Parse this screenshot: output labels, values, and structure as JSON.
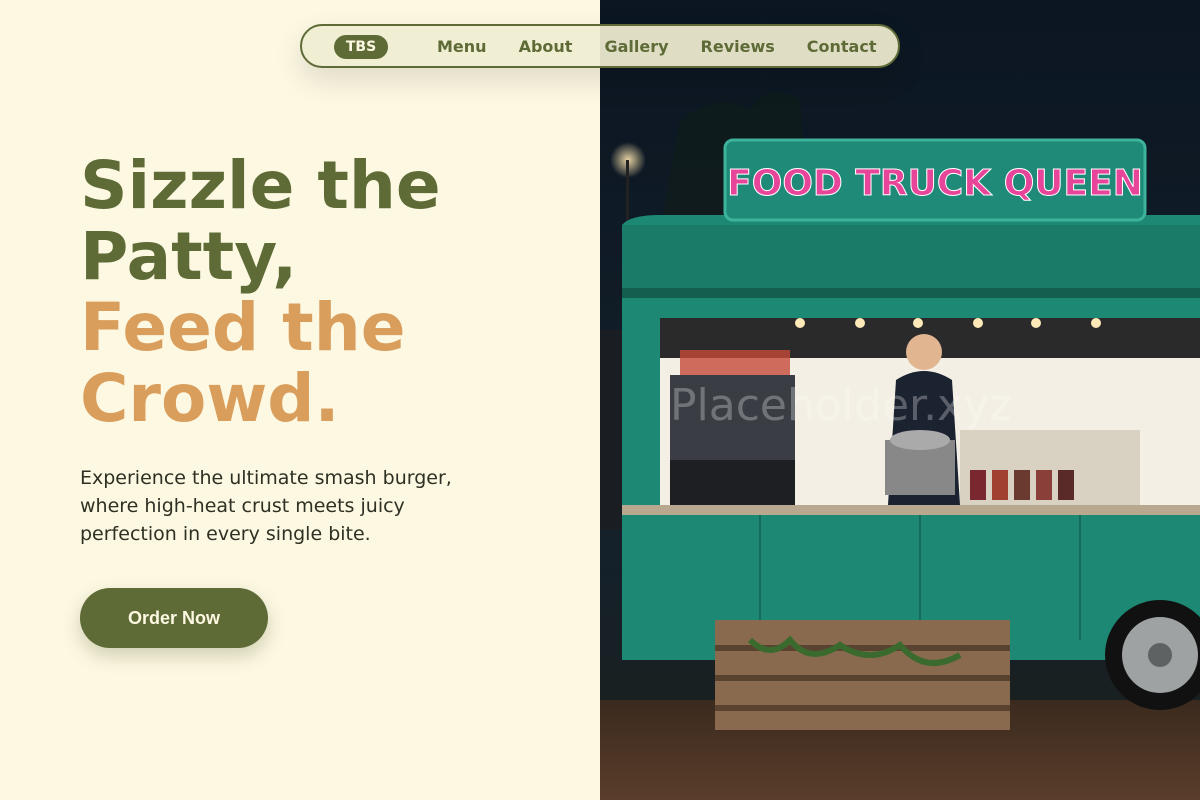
{
  "nav": {
    "logo": "TBS",
    "links": [
      "Menu",
      "About",
      "Gallery",
      "Reviews",
      "Contact"
    ]
  },
  "hero": {
    "title_lines_primary": [
      "Sizzle the",
      "Patty,"
    ],
    "title_lines_accent": [
      "Feed the",
      "Crowd."
    ],
    "description": "Experience the ultimate smash burger, where high-heat crust meets juicy perfection in every single bite.",
    "cta_label": "Order Now"
  },
  "photo": {
    "sign_text": "FOOD TRUCK QUEEN",
    "watermark": "Placeholder.xyz"
  },
  "colors": {
    "olive": "#5e6b36",
    "tan": "#d99d5c",
    "cream": "#fdf8e2",
    "truck_teal": "#1f8a78"
  }
}
